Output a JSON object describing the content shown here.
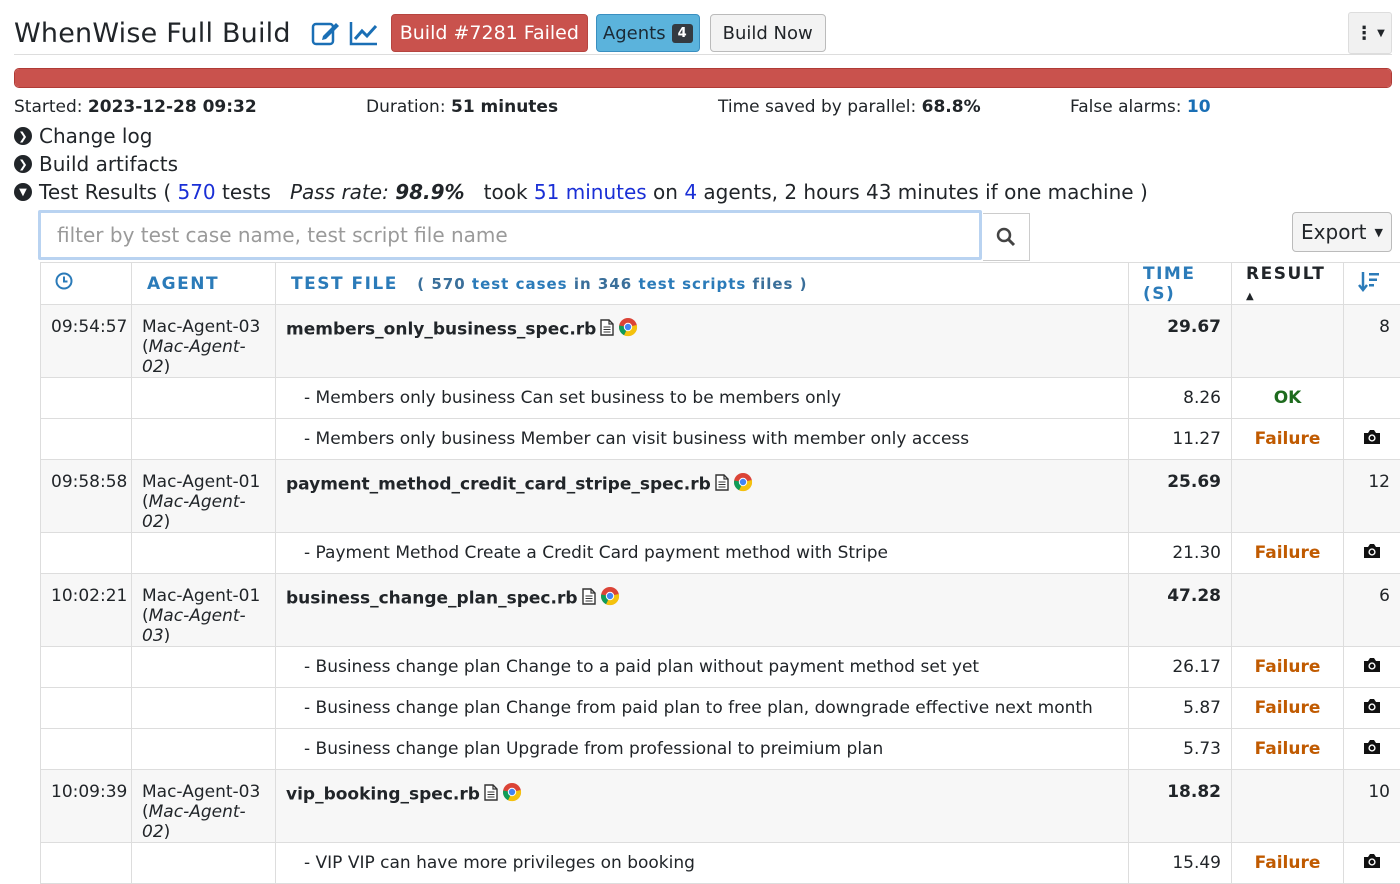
{
  "header": {
    "title": "WhenWise Full Build",
    "status_badge": "Build #7281 Failed",
    "agents_label": "Agents",
    "agents_count": "4",
    "build_now_label": "Build Now"
  },
  "progress": {
    "failed_fraction": 1.0,
    "color": "#c9524d"
  },
  "stats": {
    "started_label": "Started:",
    "started_value": "2023-12-28 09:32",
    "duration_label": "Duration:",
    "duration_value": "51 minutes",
    "saved_label": "Time saved by parallel:",
    "saved_value": "68.8%",
    "false_alarms_label": "False alarms:",
    "false_alarms_value": "10"
  },
  "sections": {
    "change_log": "Change log",
    "build_artifacts": "Build artifacts",
    "test_results_prefix": "Test Results (",
    "test_count": "570",
    "tests_word": "tests",
    "pass_rate_label": "Pass rate:",
    "pass_rate_value": "98.9%",
    "took_word": "took",
    "took_value": "51 minutes",
    "on_word": "on",
    "agents_value": "4",
    "suffix": "agents, 2 hours 43 minutes if one machine )"
  },
  "filter": {
    "placeholder": "filter by test case name, test script file name"
  },
  "export_label": "Export",
  "table": {
    "headers": {
      "agent": "AGENT",
      "test_file": "TEST FILE",
      "summary_open": "( 570",
      "summary_mid1": "test cases",
      "summary_in": "in 346",
      "summary_mid2": "test scripts",
      "summary_end": "files )",
      "time": "TIME (S)",
      "result": "RESULT"
    },
    "rows": [
      {
        "time": "09:54:57",
        "agent": "Mac-Agent-03",
        "agent_alt": "Mac-Agent-02",
        "file": "members_only_business_spec.rb",
        "duration": "29.67",
        "count": "8"
      },
      {
        "case": "- Members only business Can set business to be members only",
        "duration": "8.26",
        "result": "OK"
      },
      {
        "case": "- Members only business Member can visit business with member only access",
        "duration": "11.27",
        "result": "Failure"
      },
      {
        "time": "09:58:58",
        "agent": "Mac-Agent-01",
        "agent_alt": "Mac-Agent-02",
        "file": "payment_method_credit_card_stripe_spec.rb",
        "duration": "25.69",
        "count": "12"
      },
      {
        "case": "- Payment Method Create a Credit Card payment method with Stripe",
        "duration": "21.30",
        "result": "Failure"
      },
      {
        "time": "10:02:21",
        "agent": "Mac-Agent-01",
        "agent_alt": "Mac-Agent-03",
        "file": "business_change_plan_spec.rb",
        "duration": "47.28",
        "count": "6"
      },
      {
        "case": "- Business change plan Change to a paid plan without payment method set yet",
        "duration": "26.17",
        "result": "Failure"
      },
      {
        "case": "- Business change plan Change from paid plan to free plan, downgrade effective next month",
        "duration": "5.87",
        "result": "Failure"
      },
      {
        "case": "- Business change plan Upgrade from professional to preimium plan",
        "duration": "5.73",
        "result": "Failure"
      },
      {
        "time": "10:09:39",
        "agent": "Mac-Agent-03",
        "agent_alt": "Mac-Agent-02",
        "file": "vip_booking_spec.rb",
        "duration": "18.82",
        "count": "10"
      },
      {
        "case": "- VIP VIP can have more privileges on booking",
        "duration": "15.49",
        "result": "Failure"
      }
    ]
  },
  "colors": {
    "failed": "#c9524d",
    "ok": "#1e6b1e",
    "failure_text": "#c05a00",
    "link": "#1a6fb5"
  },
  "icons": [
    "edit-icon",
    "trend-chart-icon",
    "kebab-menu-icon",
    "chevron-right-circle-icon",
    "chevron-down-circle-icon",
    "search-icon",
    "clock-icon",
    "sort-icon",
    "document-icon",
    "chrome-icon",
    "camera-icon"
  ]
}
